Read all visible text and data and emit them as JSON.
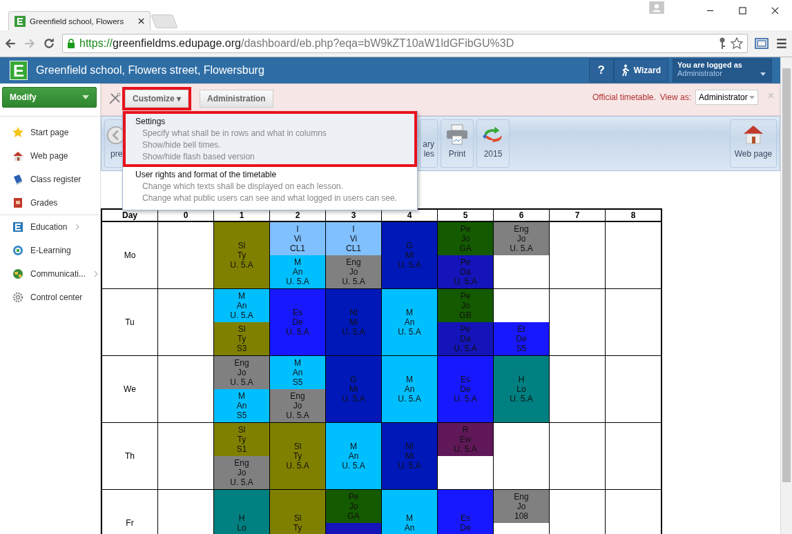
{
  "browser": {
    "tab_title": "Greenfield school, Flowers",
    "url": {
      "scheme": "https://",
      "host": "greenfieldms.edupage.org",
      "path": "/dashboard/eb.php?eqa=bW9kZT10aW1ldGFibGU%3D"
    }
  },
  "header": {
    "logo": "E",
    "title": "Greenfield school, Flowers street, Flowersburg",
    "help": "?",
    "wizard": "Wizard",
    "login_caption": "You are logged as",
    "login_user": "Administrator"
  },
  "sidebar": {
    "modify": "Modify",
    "items": [
      {
        "label": "Start page",
        "submenu": false
      },
      {
        "label": "Web page",
        "submenu": false
      },
      {
        "label": "Class register",
        "submenu": false
      },
      {
        "label": "Grades",
        "submenu": false
      },
      {
        "label": "Education",
        "submenu": true
      },
      {
        "label": "E-Learning",
        "submenu": false
      },
      {
        "label": "Communicati...",
        "submenu": true
      },
      {
        "label": "Control center",
        "submenu": false
      }
    ]
  },
  "notice": {
    "customize": {
      "label": "Customize ▾",
      "highlighted": true
    },
    "administration": "Administration",
    "status": "Official timetable.",
    "view_as_label": "View as:",
    "view_as_value": "Administrator",
    "close": "×"
  },
  "menu": {
    "sections": [
      {
        "title": "Settings",
        "highlighted": true,
        "lines": [
          "Specify what shall be in rows and what in columns",
          "Show/hide bell times.",
          "Show/hide flash based version"
        ]
      },
      {
        "title": "User rights and format of the timetable",
        "highlighted": false,
        "lines": [
          "Change which texts shall be displayed on each lesson.",
          "Change what public users can see and what logged in users can see."
        ]
      }
    ]
  },
  "toolbar": {
    "left": [
      {
        "lines": [
          "pre"
        ]
      },
      {
        "lines": [
          "ary",
          "les"
        ]
      },
      {
        "lines": [
          "Print"
        ]
      },
      {
        "lines": [
          "2015"
        ]
      }
    ],
    "right": [
      {
        "lines": [
          "Web page"
        ]
      }
    ]
  },
  "timetable": {
    "corner": "Day",
    "columns": [
      "0",
      "1",
      "2",
      "3",
      "4",
      "5",
      "6",
      "7",
      "8"
    ],
    "rows": [
      {
        "day": "Mo",
        "cells": [
          "",
          {
            "whole": {
              "color": "#808000",
              "lines": [
                "Sl",
                "Ty",
                "U. 5.A"
              ]
            }
          },
          {
            "top": {
              "color": "#80c0ff",
              "lines": [
                "I",
                "Vi",
                "CL1"
              ]
            },
            "bottom": {
              "color": "#00bfff",
              "lines": [
                "M",
                "An",
                "U. 5.A"
              ]
            }
          },
          {
            "top": {
              "color": "#80c0ff",
              "lines": [
                "I",
                "Vi",
                "CL1"
              ]
            },
            "bottom": {
              "color": "#808080",
              "lines": [
                "Eng",
                "Jo",
                "U. 5.A"
              ]
            }
          },
          {
            "whole": {
              "color": "#0018b8",
              "lines": [
                "G",
                "Mi",
                "U. 5.A"
              ]
            }
          },
          {
            "top": {
              "color": "#145a00",
              "lines": [
                "Pe",
                "Jo",
                "GA"
              ]
            },
            "bottom": {
              "color": "#1414b8",
              "lines": [
                "Pe",
                "Da",
                "U. 5.A"
              ]
            }
          },
          {
            "top": {
              "color": "#808080",
              "lines": [
                "Eng",
                "Jo",
                "U. 5.A"
              ]
            }
          },
          "",
          ""
        ]
      },
      {
        "day": "Tu",
        "cells": [
          "",
          {
            "top": {
              "color": "#00bfff",
              "lines": [
                "M",
                "An",
                "U. 5.A"
              ]
            },
            "bottom": {
              "color": "#808000",
              "lines": [
                "Sl",
                "Ty",
                "S3"
              ]
            }
          },
          {
            "whole": {
              "color": "#1818ff",
              "lines": [
                "Es",
                "De",
                "U. 5.A"
              ]
            }
          },
          {
            "whole": {
              "color": "#0018b8",
              "lines": [
                "Nt",
                "Mi",
                "U. 5.A"
              ]
            }
          },
          {
            "whole": {
              "color": "#00bfff",
              "lines": [
                "M",
                "An",
                "U. 5.A"
              ]
            }
          },
          {
            "top": {
              "color": "#145a00",
              "lines": [
                "Pe",
                "Jo",
                "GB"
              ]
            },
            "bottom": {
              "color": "#1414b8",
              "lines": [
                "Pe",
                "Da",
                "U. 5.A"
              ]
            }
          },
          {
            "bottom": {
              "color": "#1818ff",
              "lines": [
                "Et",
                "De",
                "S5"
              ]
            }
          },
          "",
          ""
        ]
      },
      {
        "day": "We",
        "cells": [
          "",
          {
            "top": {
              "color": "#808080",
              "lines": [
                "Eng",
                "Jo",
                "U. 5.A"
              ]
            },
            "bottom": {
              "color": "#00bfff",
              "lines": [
                "M",
                "An",
                "S5"
              ]
            }
          },
          {
            "top": {
              "color": "#00bfff",
              "lines": [
                "M",
                "An",
                "S5"
              ]
            },
            "bottom": {
              "color": "#808080",
              "lines": [
                "Eng",
                "Jo",
                "U. 5.A"
              ]
            }
          },
          {
            "whole": {
              "color": "#0018b8",
              "lines": [
                "G",
                "Mi",
                "U. 5.A"
              ]
            }
          },
          {
            "whole": {
              "color": "#00bfff",
              "lines": [
                "M",
                "An",
                "U. 5.A"
              ]
            }
          },
          {
            "whole": {
              "color": "#1818ff",
              "lines": [
                "Es",
                "De",
                "U. 5.A"
              ]
            }
          },
          {
            "whole": {
              "color": "#008080",
              "lines": [
                "H",
                "Lo",
                "U. 5.A"
              ]
            }
          },
          "",
          ""
        ]
      },
      {
        "day": "Th",
        "cells": [
          "",
          {
            "top": {
              "color": "#808000",
              "lines": [
                "Sl",
                "Ty",
                "S1"
              ]
            },
            "bottom": {
              "color": "#808080",
              "lines": [
                "Eng",
                "Jo",
                "U. 5.A"
              ]
            }
          },
          {
            "whole": {
              "color": "#808000",
              "lines": [
                "Sl",
                "Ty",
                "U. 5.A"
              ]
            }
          },
          {
            "whole": {
              "color": "#00bfff",
              "lines": [
                "M",
                "An",
                "U. 5.A"
              ]
            }
          },
          {
            "whole": {
              "color": "#0018b8",
              "lines": [
                "Nt",
                "Mi",
                "U. 5.A"
              ]
            }
          },
          {
            "top": {
              "color": "#601858",
              "lines": [
                "R",
                "Ew",
                "U. 5.A"
              ]
            }
          },
          "",
          "",
          ""
        ]
      },
      {
        "day": "Fr",
        "cells": [
          "",
          {
            "whole": {
              "color": "#008080",
              "lines": [
                "H",
                "Lo"
              ]
            }
          },
          {
            "whole": {
              "color": "#808000",
              "lines": [
                "Sl",
                "Ty"
              ]
            }
          },
          {
            "top": {
              "color": "#145a00",
              "lines": [
                "Pe",
                "Jo",
                "GA"
              ]
            },
            "bottom": {
              "color": "#1414b8"
            }
          },
          {
            "whole": {
              "color": "#00bfff",
              "lines": [
                "M",
                "An"
              ]
            }
          },
          {
            "whole": {
              "color": "#1818ff",
              "lines": [
                "Es",
                "De"
              ]
            }
          },
          {
            "top": {
              "color": "#808080",
              "lines": [
                "Eng",
                "Jo",
                "108"
              ]
            }
          },
          "",
          ""
        ]
      }
    ]
  }
}
